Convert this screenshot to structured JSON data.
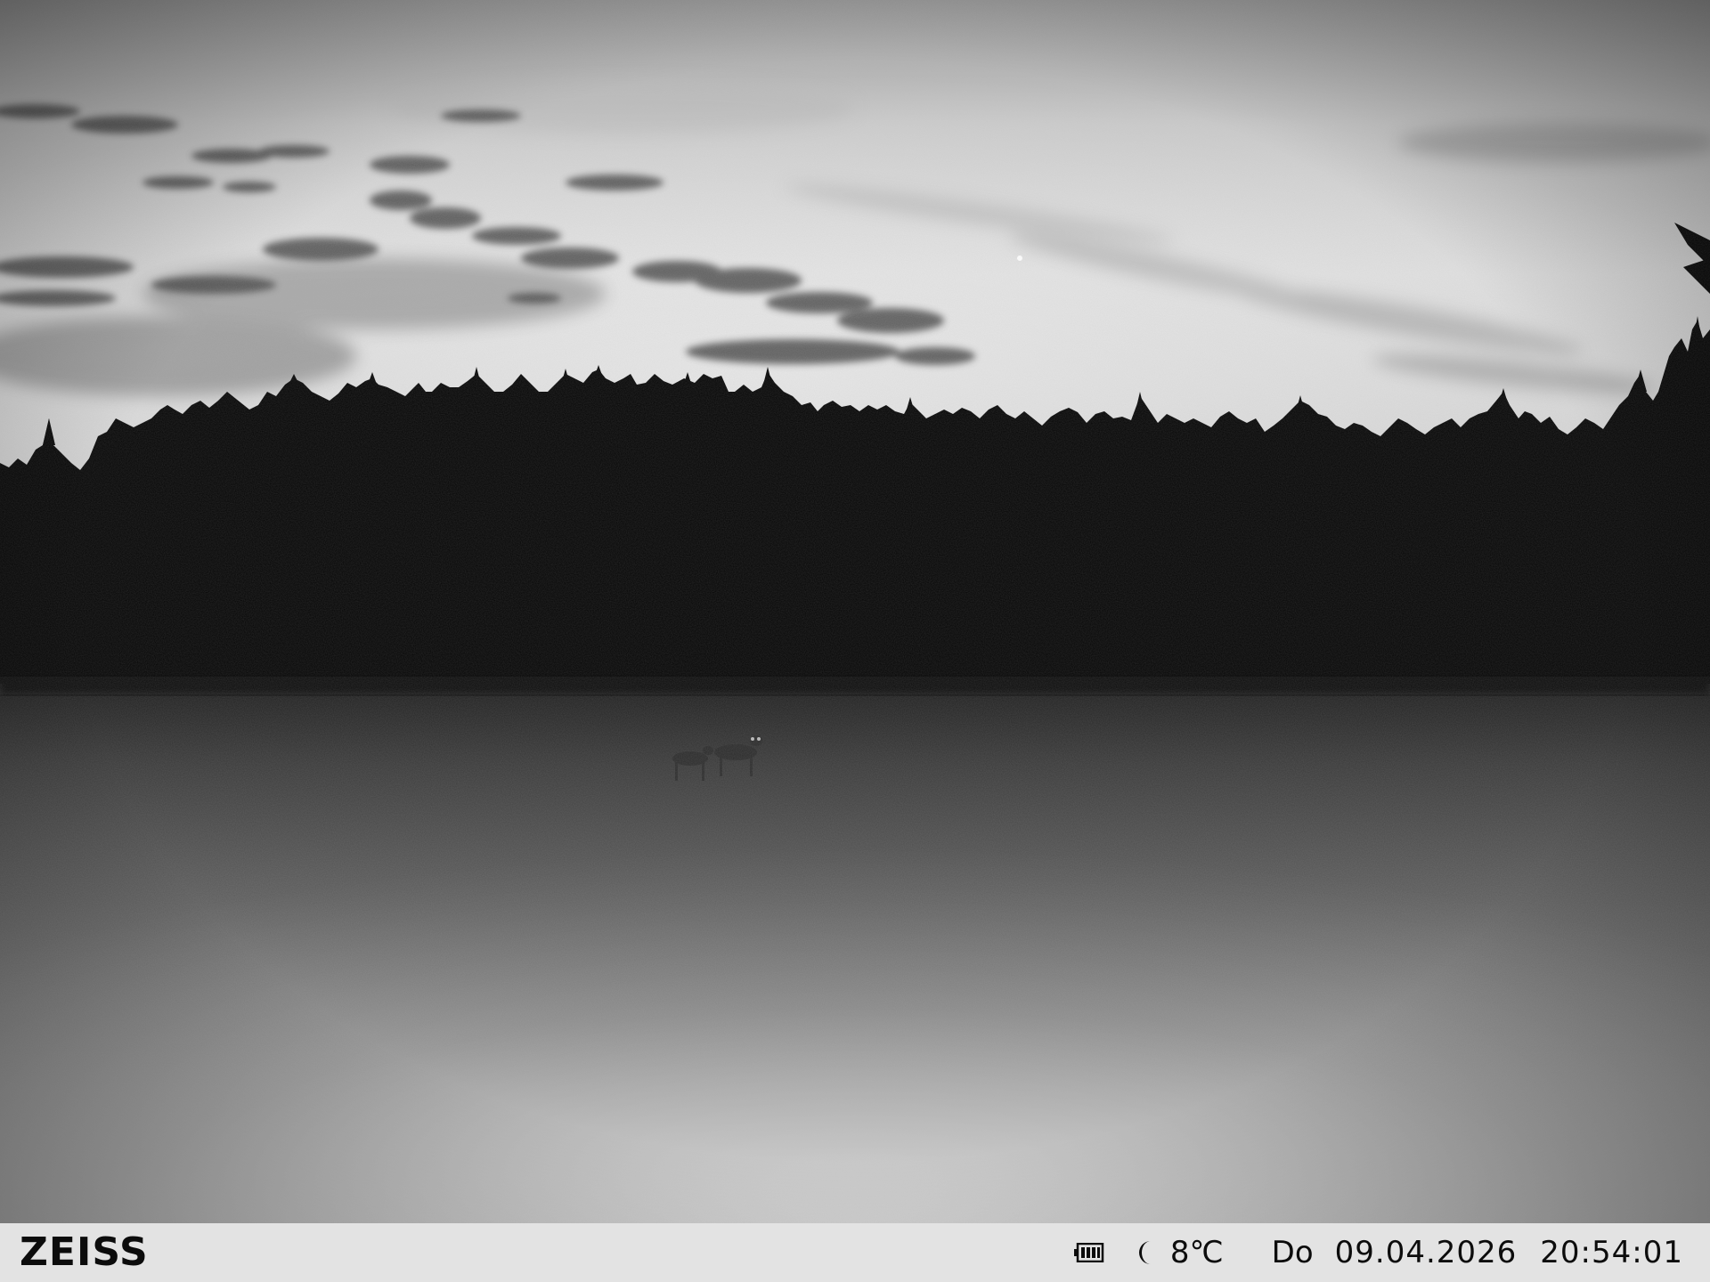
{
  "camera": {
    "brand": "ZEISS",
    "battery_icon": "battery-icon",
    "moon_icon": "moon-icon",
    "temperature": "8℃",
    "weekday": "Do",
    "date": "09.04.2026",
    "time": "20:54:01"
  },
  "colors": {
    "status_bar_bg": "#e3e3e3",
    "status_text": "#0c0c0c",
    "sky_light": "#d9d9d9",
    "treeline": "#050505",
    "field": "#8c8c8c"
  }
}
